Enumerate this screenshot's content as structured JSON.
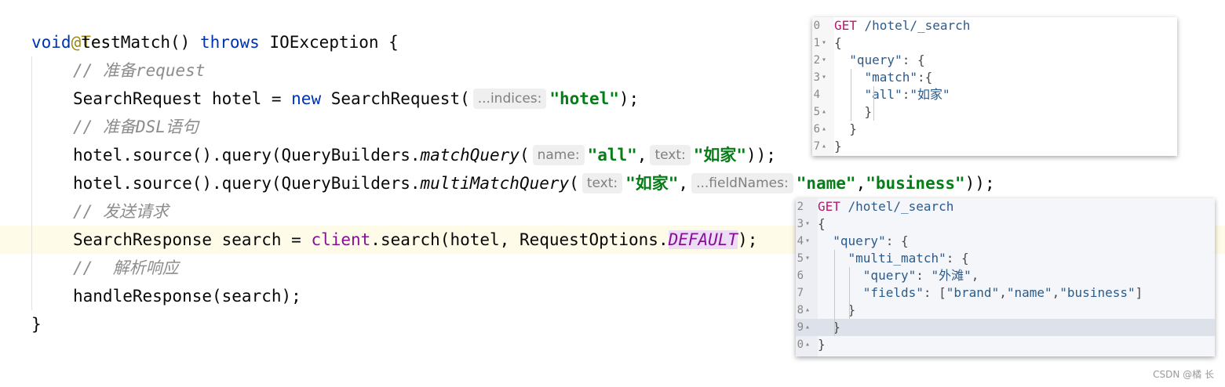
{
  "editor": {
    "annotation": "@Test",
    "sig_void": "void",
    "sig_name": " testMatch() ",
    "sig_throws": "throws",
    "sig_rest": " IOException {",
    "comment1": "// 准备request",
    "l4_a": "SearchRequest hotel = ",
    "l4_new": "new",
    "l4_b": " SearchRequest(",
    "l4_hint": "...indices:",
    "l4_str": "\"hotel\"",
    "l4_c": ");",
    "comment2": "// 准备DSL语句",
    "l6_a": "hotel.source().query(QueryBuilders.",
    "l6_method": "matchQuery",
    "l6_b": "(",
    "l6_hint1": "name:",
    "l6_str1": "\"all\"",
    "l6_comma": ",",
    "l6_hint2": "text:",
    "l6_str2": "\"如家\"",
    "l6_c": "));",
    "l7_a": "hotel.source().query(QueryBuilders.",
    "l7_method": "multiMatchQuery",
    "l7_b": "(",
    "l7_hint1": "text:",
    "l7_str1": "\"如家\"",
    "l7_comma1": ",",
    "l7_hint2": "...fieldNames:",
    "l7_str2": "\"name\"",
    "l7_comma2": ",",
    "l7_str3": "\"business\"",
    "l7_c": "));",
    "comment3": "// 发送请求",
    "l9_a": "SearchResponse search = ",
    "l9_client": "client",
    "l9_b": ".search(hotel, RequestOptions.",
    "l9_const": "DEFAULT",
    "l9_c": ");",
    "comment4": "//  解析响应",
    "l11": "handleResponse(search);",
    "l12": "}"
  },
  "popup1": {
    "lines": [
      {
        "num": "0",
        "fold": "",
        "parts": [
          [
            "verb",
            "GET"
          ],
          [
            "url",
            " /hotel/_search"
          ]
        ]
      },
      {
        "num": "1",
        "fold": "▾",
        "parts": [
          [
            "plain",
            "{"
          ]
        ]
      },
      {
        "num": "2",
        "fold": "▾",
        "parts": [
          [
            "plain",
            "  "
          ],
          [
            "key",
            "\"query\""
          ],
          [
            "plain",
            ": {"
          ]
        ]
      },
      {
        "num": "3",
        "fold": "▾",
        "parts": [
          [
            "plain",
            "    "
          ],
          [
            "key",
            "\"match\""
          ],
          [
            "plain",
            ":{"
          ]
        ]
      },
      {
        "num": "4",
        "fold": "",
        "parts": [
          [
            "plain",
            "    "
          ],
          [
            "key",
            "\"all\""
          ],
          [
            "plain",
            ":"
          ],
          [
            "val",
            "\"如家\""
          ]
        ]
      },
      {
        "num": "5",
        "fold": "▴",
        "parts": [
          [
            "plain",
            "    }"
          ]
        ]
      },
      {
        "num": "6",
        "fold": "▴",
        "parts": [
          [
            "plain",
            "  }"
          ]
        ]
      },
      {
        "num": "7",
        "fold": "▴",
        "parts": [
          [
            "plain",
            "}"
          ]
        ]
      }
    ]
  },
  "popup2": {
    "lines": [
      {
        "num": "2",
        "fold": "",
        "parts": [
          [
            "verb",
            "GET"
          ],
          [
            "url",
            " /hotel/_search"
          ]
        ]
      },
      {
        "num": "3",
        "fold": "▾",
        "parts": [
          [
            "plain",
            "{"
          ]
        ]
      },
      {
        "num": "4",
        "fold": "▾",
        "parts": [
          [
            "plain",
            "  "
          ],
          [
            "key",
            "\"query\""
          ],
          [
            "plain",
            ": {"
          ]
        ]
      },
      {
        "num": "5",
        "fold": "▾",
        "parts": [
          [
            "plain",
            "    "
          ],
          [
            "key",
            "\"multi_match\""
          ],
          [
            "plain",
            ": {"
          ]
        ]
      },
      {
        "num": "6",
        "fold": "",
        "parts": [
          [
            "plain",
            "      "
          ],
          [
            "key",
            "\"query\""
          ],
          [
            "plain",
            ": "
          ],
          [
            "val",
            "\"外滩\""
          ],
          [
            "plain",
            ","
          ]
        ]
      },
      {
        "num": "7",
        "fold": "",
        "parts": [
          [
            "plain",
            "      "
          ],
          [
            "key",
            "\"fields\""
          ],
          [
            "plain",
            ": ["
          ],
          [
            "val",
            "\"brand\""
          ],
          [
            "plain",
            ","
          ],
          [
            "val",
            "\"name\""
          ],
          [
            "plain",
            ","
          ],
          [
            "val",
            "\"business\""
          ],
          [
            "plain",
            "]"
          ]
        ]
      },
      {
        "num": "8",
        "fold": "▴",
        "parts": [
          [
            "plain",
            "    }"
          ]
        ]
      },
      {
        "num": "9",
        "fold": "▴",
        "parts": [
          [
            "plain",
            "  }"
          ]
        ]
      },
      {
        "num": "0",
        "fold": "▴",
        "parts": [
          [
            "plain",
            "}"
          ]
        ]
      }
    ]
  },
  "watermark": "CSDN @橘 长"
}
